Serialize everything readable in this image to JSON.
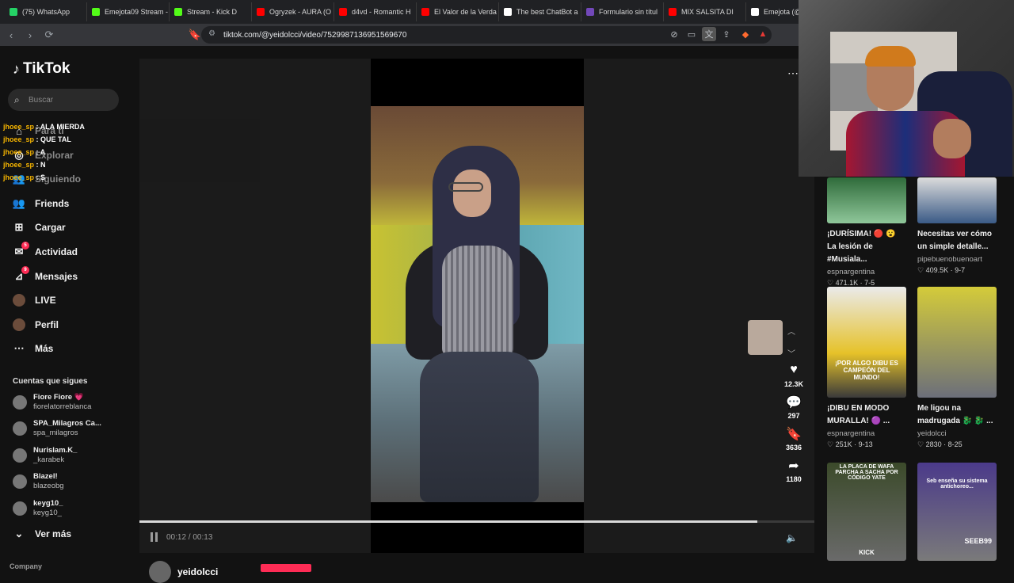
{
  "browser": {
    "tabs": [
      {
        "title": "(75) WhatsApp",
        "color": "#25d366"
      },
      {
        "title": "Emejota09 Stream -",
        "color": "#53fc18"
      },
      {
        "title": "Stream - Kick D",
        "color": "#53fc18"
      },
      {
        "title": "Ogryzek - AURA (O",
        "color": "#ff0000"
      },
      {
        "title": "d4vd - Romantic H",
        "color": "#ff0000"
      },
      {
        "title": "El Valor de la Verda",
        "color": "#ff0000"
      },
      {
        "title": "The best ChatBot a",
        "color": "#ffffff"
      },
      {
        "title": "Formulario sin títul",
        "color": "#7248b9"
      },
      {
        "title": "MIX SALSITA DI",
        "color": "#ff0000"
      },
      {
        "title": "Emejota (@em",
        "color": "#ffffff"
      }
    ],
    "url": "tiktok.com/@yeidolcci/video/7529987136951569670"
  },
  "sidebar": {
    "logo": "TikTok",
    "search_placeholder": "Buscar",
    "nav": [
      {
        "label": "Para ti",
        "icon": "home-icon"
      },
      {
        "label": "Explorar",
        "icon": "compass-icon"
      },
      {
        "label": "Siguiendo",
        "icon": "following-icon"
      },
      {
        "label": "Friends",
        "icon": "friends-icon"
      },
      {
        "label": "Cargar",
        "icon": "upload-icon"
      },
      {
        "label": "Actividad",
        "icon": "activity-icon",
        "badge": "5"
      },
      {
        "label": "Mensajes",
        "icon": "messages-icon",
        "badge": "9"
      },
      {
        "label": "LIVE",
        "icon": "live-icon"
      },
      {
        "label": "Perfil",
        "icon": "profile-icon"
      },
      {
        "label": "Más",
        "icon": "more-icon"
      }
    ],
    "following_title": "Cuentas que sigues",
    "following": [
      {
        "name": "Fiore Fiore 💗",
        "handle": "fiorelatorreblanca"
      },
      {
        "name": "SPA_Milagros Ca...",
        "handle": "spa_milagros"
      },
      {
        "name": "Nurislam.K_",
        "handle": "_karabek"
      },
      {
        "name": "Blazel!",
        "handle": "blazeobg"
      },
      {
        "name": "keyg10_",
        "handle": "keyg10_"
      }
    ],
    "see_more": "Ver más",
    "company": "Company"
  },
  "chat": [
    {
      "user": "jhoee_sp",
      "msg": "ALA MIERDA"
    },
    {
      "user": "jhoee_sp",
      "msg": "QUE TAL"
    },
    {
      "user": "jhoee_sp",
      "msg": "A"
    },
    {
      "user": "jhoee_sp",
      "msg": "N"
    },
    {
      "user": "jhoee_sp",
      "msg": "S"
    }
  ],
  "player": {
    "time": "00:12 / 00:13",
    "progress": 0.915,
    "author": "yeidolcci"
  },
  "actions": {
    "likes": "12.3K",
    "comments": "297",
    "saves": "3636",
    "shares": "1180"
  },
  "recommended": [
    {
      "title": "¡DURÍSIMA! 🔴 😮 La lesión de #Musiala...",
      "channel": "espnargentina",
      "stats": "♡ 471.1K · 7-5"
    },
    {
      "title": "Necesitas ver cómo un simple detalle...",
      "channel": "pipebuenobuenoart",
      "stats": "♡ 409.5K · 9-7"
    },
    {
      "title": "¡DIBU EN MODO MURALLA! 🟣 ...",
      "channel": "espnargentina",
      "stats": "♡ 251K · 9-13"
    },
    {
      "title": "Me ligou na madrugada 🐉 🐉 ...",
      "channel": "yeidolcci",
      "stats": "♡ 2830 · 8-25"
    },
    {
      "title": "",
      "channel": "",
      "stats": ""
    },
    {
      "title": "",
      "channel": "",
      "stats": ""
    }
  ],
  "thumb_texts": {
    "dibu": "¡POR ALGO DIBU ES CAMPEÓN DEL MUNDO!",
    "kick_top": "LA PLACA DE WAFA PARCHA A SACHA POR CÓDIGO YATE",
    "kick_bottom": "KICK",
    "seeb_top": "Seb enseña su sistema antichoreo...",
    "seeb_bottom": "SEEB99"
  }
}
